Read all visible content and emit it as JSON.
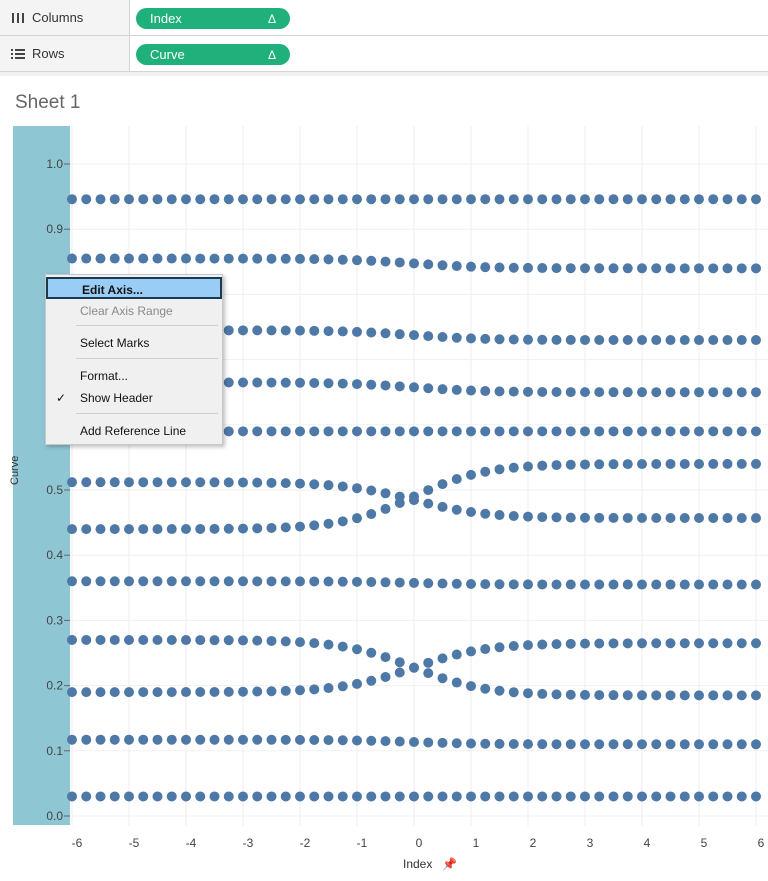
{
  "shelves": {
    "columns": {
      "label": "Columns",
      "pill": "Index",
      "pill_suffix": "Δ",
      "icon": "columns-icon"
    },
    "rows": {
      "label": "Rows",
      "pill": "Curve",
      "pill_suffix": "Δ",
      "icon": "rows-icon"
    }
  },
  "sheet": {
    "title": "Sheet 1"
  },
  "context_menu": {
    "items": [
      {
        "label": "Edit Axis...",
        "state": "highlighted"
      },
      {
        "label": "Clear Axis Range",
        "state": "disabled"
      },
      {
        "label": "Select Marks",
        "state": "normal"
      },
      {
        "label": "Format...",
        "state": "normal"
      },
      {
        "label": "Show Header",
        "state": "checked"
      },
      {
        "label": "Add Reference Line",
        "state": "normal"
      }
    ]
  },
  "colors": {
    "mark": "#4e79a7",
    "pill": "#1fb07c",
    "axis_band": "#8fc6d4"
  },
  "chart_data": {
    "type": "scatter",
    "xlabel": "Index",
    "ylabel": "Curve",
    "xlim": [
      -6,
      6
    ],
    "ylim": [
      0,
      1
    ],
    "x_ticks": [
      "-6",
      "-5",
      "-4",
      "-3",
      "-2",
      "-1",
      "0",
      "1",
      "2",
      "3",
      "4",
      "5",
      "6"
    ],
    "y_ticks": [
      "0.0",
      "0.1",
      "0.2",
      "0.3",
      "0.4",
      "0.5",
      "0.6",
      "0.7",
      "0.8",
      "0.9",
      "1.0"
    ],
    "x_step": 0.25,
    "series": [
      {
        "left": 0.03,
        "right": 0.03
      },
      {
        "left": 0.117,
        "right": 0.11
      },
      {
        "left": 0.19,
        "right": 0.265
      },
      {
        "left": 0.27,
        "right": 0.185
      },
      {
        "left": 0.36,
        "right": 0.355
      },
      {
        "left": 0.44,
        "right": 0.54
      },
      {
        "left": 0.512,
        "right": 0.457
      },
      {
        "left": 0.59,
        "right": 0.59
      },
      {
        "left": 0.665,
        "right": 0.65
      },
      {
        "left": 0.745,
        "right": 0.73
      },
      {
        "left": 0.855,
        "right": 0.84
      },
      {
        "left": 0.946,
        "right": 0.946
      }
    ]
  }
}
